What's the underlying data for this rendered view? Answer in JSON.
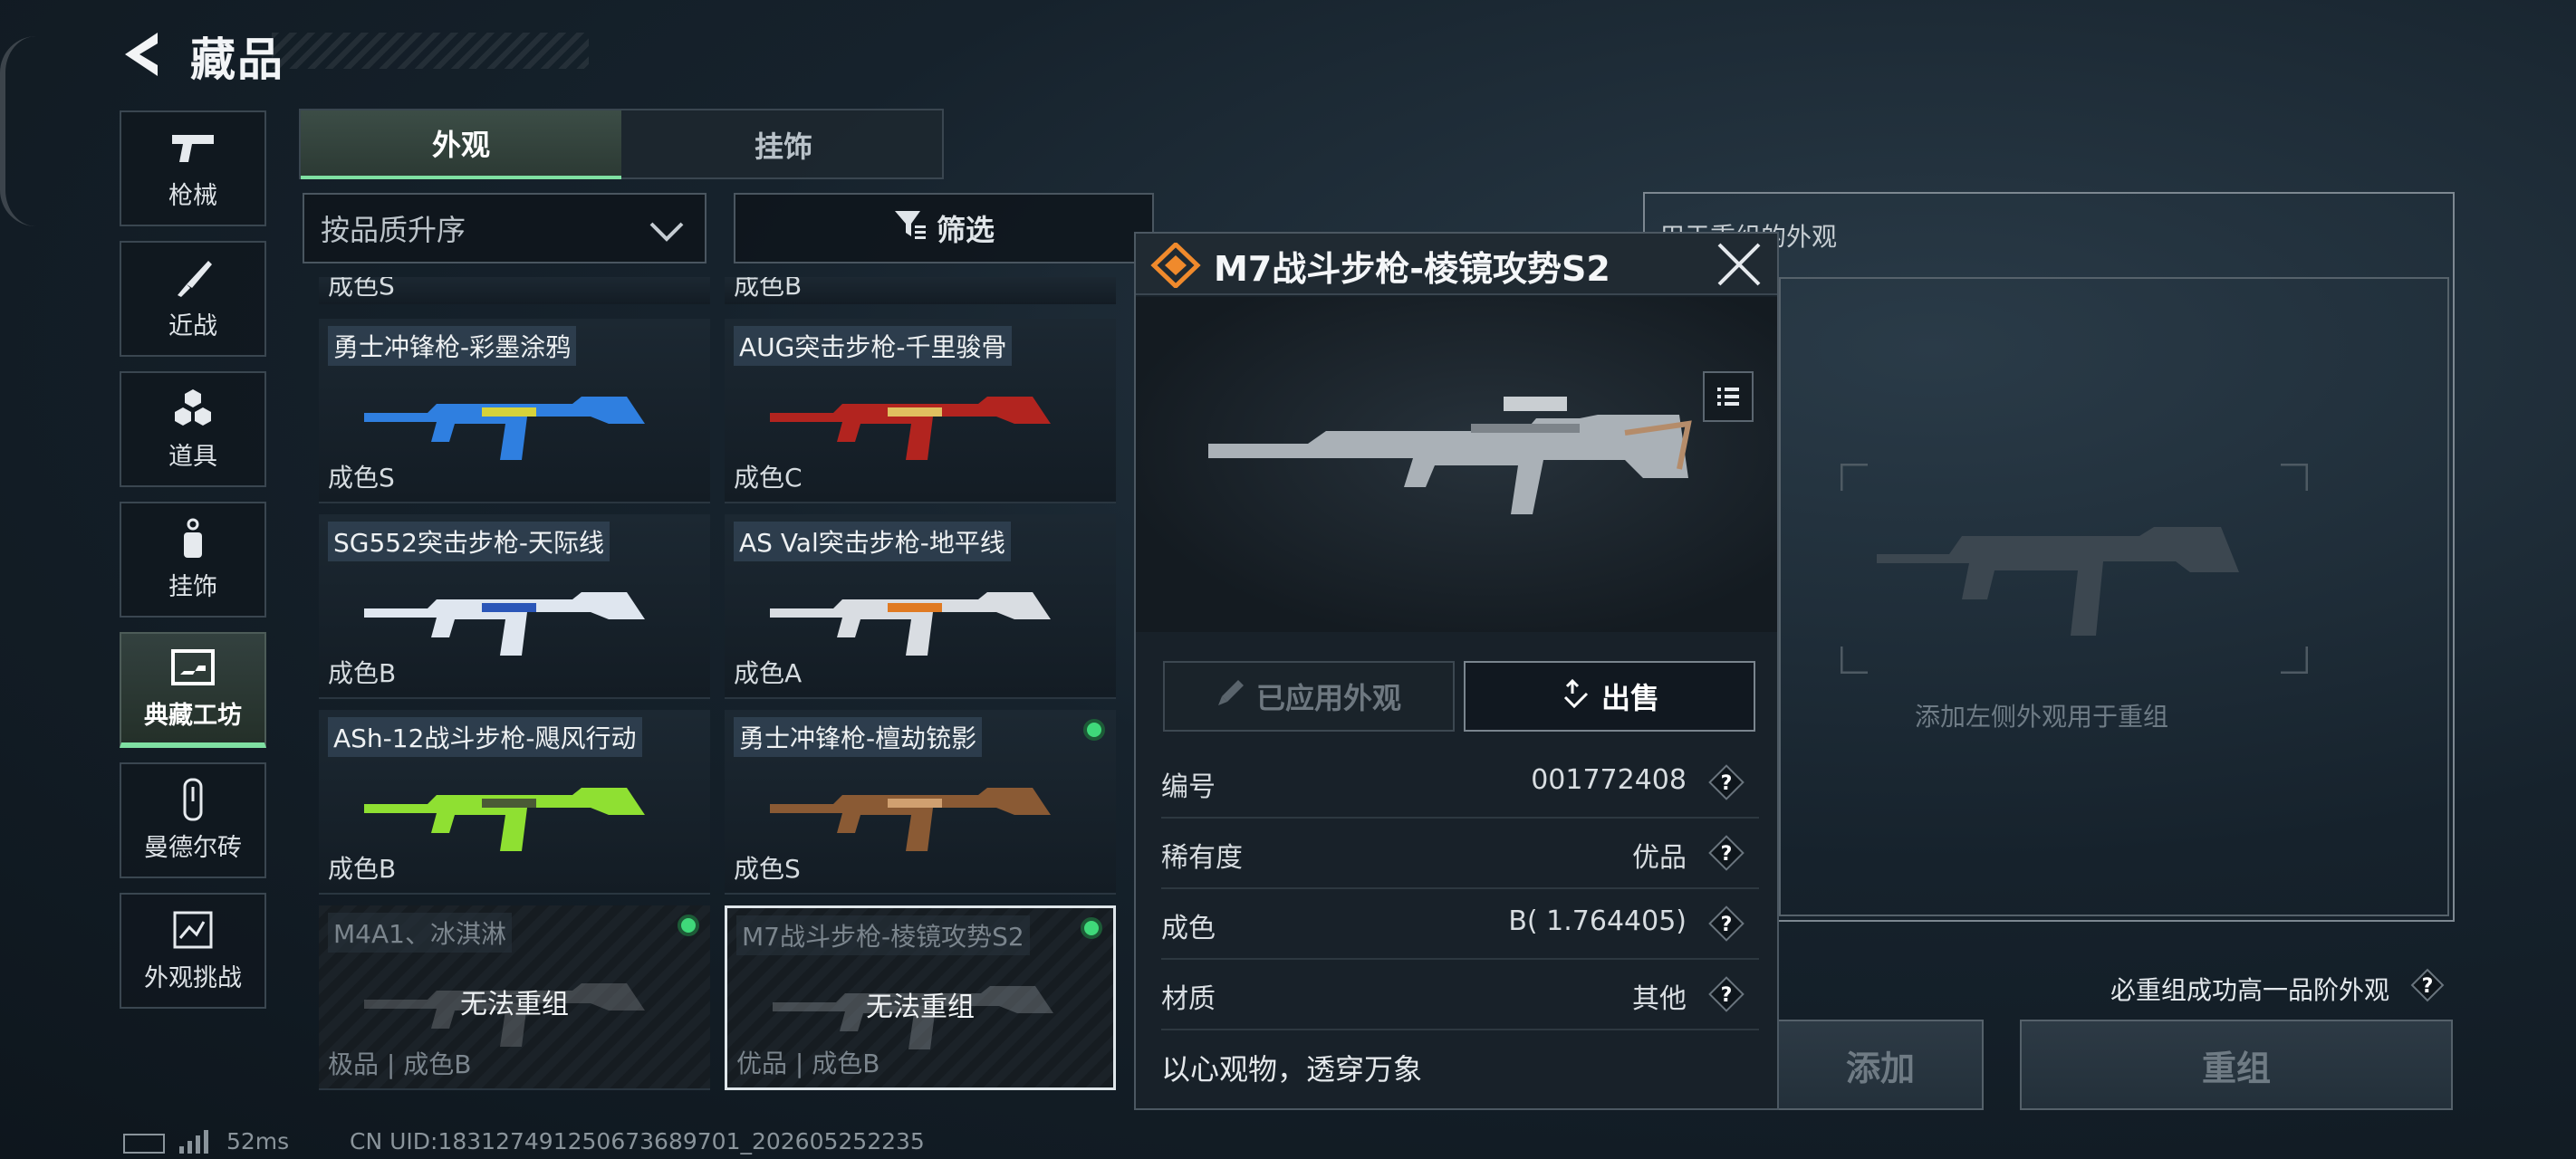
{
  "header": {
    "title": "藏品"
  },
  "nav": [
    {
      "label": "枪械",
      "icon": "pistol-icon"
    },
    {
      "label": "近战",
      "icon": "knife-icon"
    },
    {
      "label": "道具",
      "icon": "grenade-icon"
    },
    {
      "label": "挂饰",
      "icon": "charm-icon"
    },
    {
      "label": "典藏工坊",
      "icon": "workshop-icon",
      "active": true
    },
    {
      "label": "曼德尔砖",
      "icon": "brick-icon"
    },
    {
      "label": "外观挑战",
      "icon": "challenge-icon"
    }
  ],
  "tabs": [
    {
      "label": "外观",
      "active": true
    },
    {
      "label": "挂饰",
      "active": false
    }
  ],
  "sort": {
    "value": "按品质升序"
  },
  "filter": {
    "label": "筛选"
  },
  "partial_row": [
    "成色S",
    "成色B"
  ],
  "cards": [
    {
      "name": "勇士冲锋枪-彩墨涂鸦",
      "footer": "成色S",
      "colors": [
        "#2f7fe0",
        "#d6d23a"
      ]
    },
    {
      "name": "AUG突击步枪-千里骏骨",
      "footer": "成色C",
      "colors": [
        "#b2241f",
        "#e0c060"
      ]
    },
    {
      "name": "SG552突击步枪-天际线",
      "footer": "成色B",
      "colors": [
        "#dfe6ef",
        "#2b56b8"
      ]
    },
    {
      "name": "AS Val突击步枪-地平线",
      "footer": "成色A",
      "colors": [
        "#d9dde2",
        "#e07a22"
      ]
    },
    {
      "name": "ASh-12战斗步枪-飓风行动",
      "footer": "成色B",
      "colors": [
        "#8fe032",
        "#4a5a36"
      ]
    },
    {
      "name": "勇士冲锋枪-檀劫铳影",
      "footer": "成色S",
      "colors": [
        "#8a5a34",
        "#d0a070"
      ],
      "equipped": true
    },
    {
      "name": "M4A1、冰淇淋",
      "footer": "极品 | 成色B",
      "blocked": "无法重组",
      "equipped": true,
      "colors": [
        "#8b8f94",
        "#5a6066"
      ]
    },
    {
      "name": "M7战斗步枪-棱镜攻势S2",
      "footer": "优品 | 成色B",
      "blocked": "无法重组",
      "equipped": true,
      "selected": true,
      "colors": [
        "#9aa0a6",
        "#6a7076"
      ]
    }
  ],
  "detail": {
    "title": "M7战斗步枪-棱镜攻势S2",
    "applied_label": "已应用外观",
    "sell_label": "出售",
    "attrs": [
      {
        "key": "编号",
        "value": "001772408"
      },
      {
        "key": "稀有度",
        "value": "优品"
      },
      {
        "key": "成色",
        "value": "B( 1.764405)"
      },
      {
        "key": "材质",
        "value": "其他"
      }
    ],
    "quote": "以心观物，透穿万象"
  },
  "recombine": {
    "title": "用于重组的外观",
    "hint": "添加左侧外观用于重组",
    "note": "必重组成功高一品阶外观",
    "add_label": "添加",
    "recombine_label": "重组"
  },
  "status": {
    "ping": "52ms",
    "uid": "CN UID:183127491250673689701_202605252235"
  },
  "colors": {
    "accent": "#7fe0a2",
    "equipped_dot": "#3fd97a",
    "logo": "#f08a2c"
  }
}
